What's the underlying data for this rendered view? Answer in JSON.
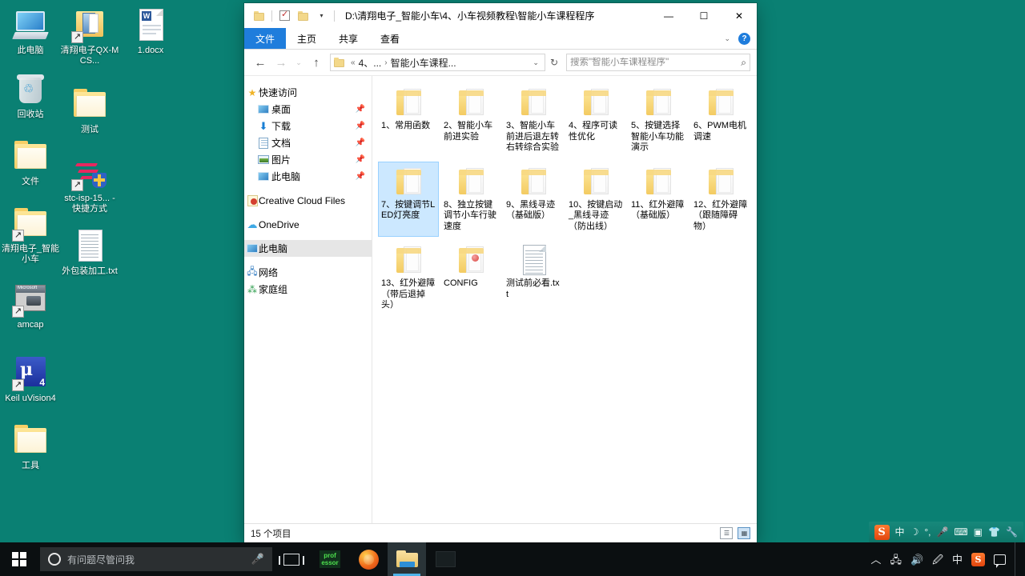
{
  "desktop": {
    "icons_col1": [
      {
        "label": "此电脑",
        "type": "monitor-icon"
      },
      {
        "label": "回收站",
        "type": "recycle-bin-icon"
      },
      {
        "label": "文件",
        "type": "folder-icon"
      },
      {
        "label": "清翔电子_智能小车",
        "type": "folder-shortcut-icon"
      },
      {
        "label": "amcap",
        "type": "amcap-icon"
      },
      {
        "label": "Keil uVision4",
        "type": "keil-icon"
      },
      {
        "label": "工具",
        "type": "folder-icon"
      }
    ],
    "icons_col2": [
      {
        "label": "清翔电子QX-MCS...",
        "type": "folder-shortcut-icon"
      },
      {
        "label": "测试",
        "type": "folder-icon"
      },
      {
        "label": "stc-isp-15... - 快捷方式",
        "type": "stc-isp-shortcut-icon"
      },
      {
        "label": "外包装加工.txt",
        "type": "text-file-icon"
      }
    ],
    "icons_col3": [
      {
        "label": "1.docx",
        "type": "word-document-icon"
      }
    ]
  },
  "explorer": {
    "title_path": "D:\\清翔电子_智能小车\\4、小车视频教程\\智能小车课程程序",
    "quick_access_toolbar": [
      {
        "name": "folder-icon",
        "glyph": "folder"
      },
      {
        "name": "properties-icon",
        "glyph": "check"
      },
      {
        "name": "new-folder-icon",
        "glyph": "folder"
      },
      {
        "name": "customize-caret",
        "glyph": "▾"
      }
    ],
    "window_controls": {
      "minimize": "—",
      "maximize": "☐",
      "close": "✕"
    },
    "ribbon_tabs": [
      {
        "label": "文件",
        "active": true
      },
      {
        "label": "主页",
        "active": false
      },
      {
        "label": "共享",
        "active": false
      },
      {
        "label": "查看",
        "active": false
      }
    ],
    "ribbon_right": {
      "collapse": "⌄",
      "help": "?"
    },
    "nav_buttons": {
      "back": "←",
      "forward": "→",
      "recent": "⌄",
      "up": "↑"
    },
    "address": {
      "chevrons": "«",
      "crumb1": "4、...",
      "separator": "›",
      "crumb2": "智能小车课程...",
      "dropdown": "⌄",
      "refresh": "↻"
    },
    "search": {
      "placeholder": "搜索\"智能小车课程程序\"",
      "value": "",
      "icon": "search-icon"
    },
    "nav_pane": {
      "quick_access": {
        "label": "快速访问",
        "icon": "star-pin-icon"
      },
      "pinned": [
        {
          "label": "桌面",
          "icon": "desktop-icon",
          "pin": "📌"
        },
        {
          "label": "下载",
          "icon": "download-icon",
          "pin": "📌"
        },
        {
          "label": "文档",
          "icon": "documents-icon",
          "pin": "📌"
        },
        {
          "label": "图片",
          "icon": "pictures-icon",
          "pin": "📌"
        },
        {
          "label": "此电脑",
          "icon": "this-pc-icon",
          "pin": "📌"
        }
      ],
      "roots": [
        {
          "label": "Creative Cloud Files",
          "icon": "creative-cloud-icon",
          "selected": false
        },
        {
          "label": "OneDrive",
          "icon": "onedrive-icon",
          "selected": false
        },
        {
          "label": "此电脑",
          "icon": "this-pc-icon",
          "selected": true
        },
        {
          "label": "网络",
          "icon": "network-icon",
          "selected": false
        },
        {
          "label": "家庭组",
          "icon": "homegroup-icon",
          "selected": false
        }
      ]
    },
    "files": [
      {
        "name": "1、常用函数",
        "type": "folder",
        "selected": false
      },
      {
        "name": "2、智能小车前进实验",
        "type": "folder",
        "selected": false
      },
      {
        "name": "3、智能小车前进后退左转右转综合实验",
        "type": "folder",
        "selected": false
      },
      {
        "name": "4、程序可读性优化",
        "type": "folder",
        "selected": false
      },
      {
        "name": "5、按键选择智能小车功能演示",
        "type": "folder",
        "selected": false
      },
      {
        "name": "6、PWM电机调速",
        "type": "folder",
        "selected": false
      },
      {
        "name": "7、按键调节LED灯亮度",
        "type": "folder",
        "selected": true
      },
      {
        "name": "8、独立按键调节小车行驶速度",
        "type": "folder",
        "selected": false
      },
      {
        "name": "9、黑线寻迹（基础版）",
        "type": "folder",
        "selected": false
      },
      {
        "name": "10、按键启动_黑线寻迹（防出线）",
        "type": "folder",
        "selected": false
      },
      {
        "name": "11、红外避障（基础版）",
        "type": "folder",
        "selected": false
      },
      {
        "name": "12、红外避障（跟随障碍物）",
        "type": "folder",
        "selected": false
      },
      {
        "name": "13、红外避障（带后退掉头）",
        "type": "folder",
        "selected": false
      },
      {
        "name": "CONFIG",
        "type": "folder-config",
        "selected": false
      },
      {
        "name": "测试前必看.txt",
        "type": "text-file",
        "selected": false
      }
    ],
    "status": {
      "item_count": "15 个项目",
      "view_details_icon": "details-view-icon",
      "view_large_icon": "large-icons-view-icon"
    }
  },
  "ime_bar": {
    "items": [
      {
        "name": "sogou-logo-icon",
        "glyph": "S"
      },
      {
        "name": "chinese-mode-icon",
        "glyph": "中"
      },
      {
        "name": "moon-icon",
        "glyph": "☽"
      },
      {
        "name": "punctuation-icon",
        "glyph": "°,"
      },
      {
        "name": "voice-input-icon",
        "glyph": "🎤"
      },
      {
        "name": "soft-keyboard-icon",
        "glyph": "⌨"
      },
      {
        "name": "screenshot-icon",
        "glyph": "▣"
      },
      {
        "name": "skin-icon",
        "glyph": "👕"
      },
      {
        "name": "toolbox-icon",
        "glyph": "🔧"
      }
    ]
  },
  "taskbar": {
    "start": {
      "name": "start-button",
      "label": ""
    },
    "search": {
      "placeholder": "有问题尽管问我",
      "mic_icon": "microphone-icon"
    },
    "buttons": [
      {
        "name": "task-view-button",
        "label": ""
      },
      {
        "name": "professor-app-button",
        "label": "prof essor"
      },
      {
        "name": "browser-app-button",
        "label": ""
      },
      {
        "name": "file-explorer-button",
        "label": "",
        "active": true
      },
      {
        "name": "minimized-app-button",
        "label": ""
      }
    ],
    "tray": [
      {
        "name": "show-hidden-icons",
        "glyph": "︿"
      },
      {
        "name": "network-icon",
        "glyph": "🖧"
      },
      {
        "name": "volume-icon",
        "glyph": "🔊"
      },
      {
        "name": "pen-icon",
        "glyph": "🖉"
      },
      {
        "name": "ime-chinese-icon",
        "glyph": "中"
      },
      {
        "name": "sogou-tray-icon",
        "glyph": "S"
      },
      {
        "name": "action-center-icon",
        "glyph": "▭"
      }
    ]
  },
  "colors": {
    "desktop_bg": "#0a8073",
    "accent_blue": "#1f7ddc",
    "selection_blue": "#cce8ff",
    "taskbar_bg": "#0b0f11",
    "folder_yellow": "#f3cb62",
    "cursor_highlight": "#409656"
  }
}
